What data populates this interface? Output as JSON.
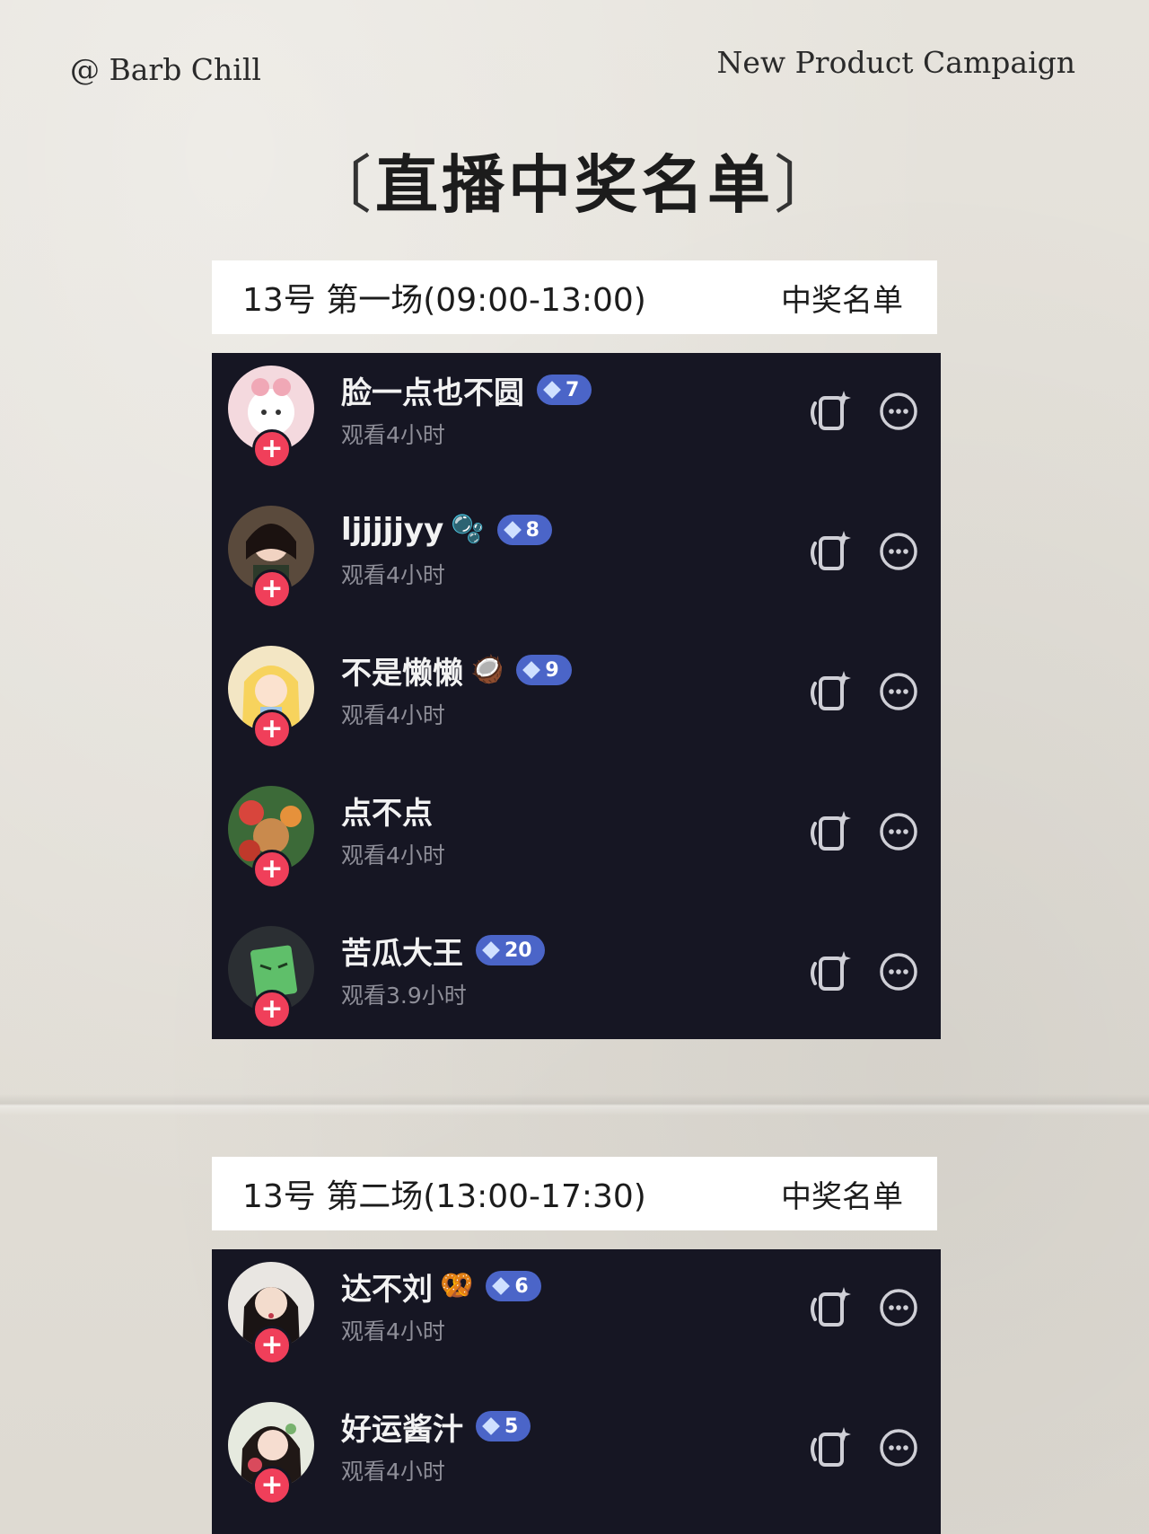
{
  "header": {
    "account": "@ Barb Chill",
    "campaign": "New Product Campaign",
    "title": "直播中奖名单",
    "bracket_left": "〔",
    "bracket_right": "〕"
  },
  "sessions": [
    {
      "label": "13号 第一场(09:00-13:00)",
      "winners_label": "中奖名单",
      "users": [
        {
          "name": "脸一点也不圆",
          "emoji": "",
          "level": "7",
          "watch": "观看4小时"
        },
        {
          "name": "ljjjjjyy",
          "emoji": "🫧",
          "level": "8",
          "watch": "观看4小时"
        },
        {
          "name": "不是懒懒",
          "emoji": "🥥",
          "level": "9",
          "watch": "观看4小时"
        },
        {
          "name": "点不点",
          "emoji": "",
          "level": "",
          "watch": "观看4小时"
        },
        {
          "name": "苦瓜大王",
          "emoji": "",
          "level": "20",
          "watch": "观看3.9小时"
        }
      ]
    },
    {
      "label": "13号 第二场(13:00-17:30)",
      "winners_label": "中奖名单",
      "users": [
        {
          "name": "达不刘",
          "emoji": "🥨",
          "level": "6",
          "watch": "观看4小时"
        },
        {
          "name": "好运酱汁",
          "emoji": "",
          "level": "5",
          "watch": "观看4小时"
        }
      ]
    }
  ],
  "icons": {
    "follow": "plus-icon",
    "share": "share-sparkle-icon",
    "message": "message-bubble-icon",
    "badge": "diamond-icon"
  },
  "colors": {
    "panel_bg": "#161623",
    "badge_bg": "#4b65c8",
    "follow_bg": "#f03f5a",
    "paper_bg": "#e2dfd8"
  }
}
